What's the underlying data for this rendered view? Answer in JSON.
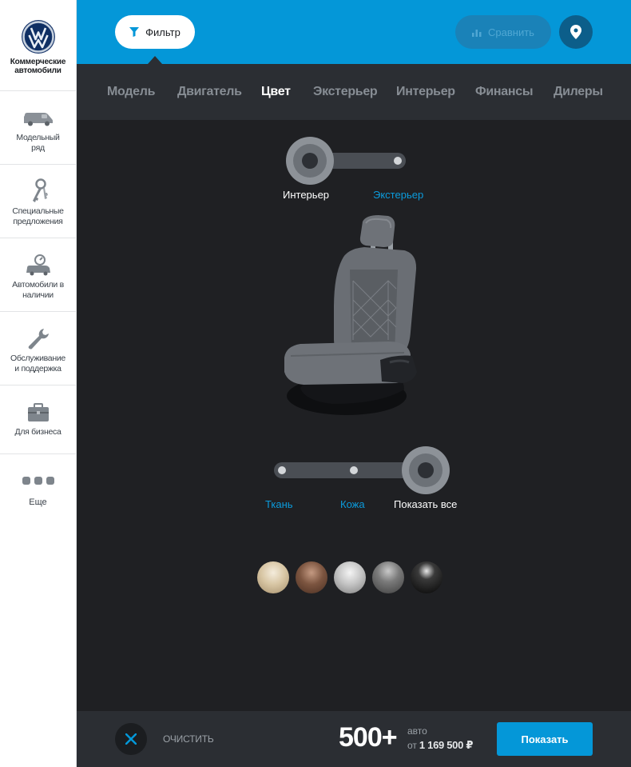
{
  "brand": {
    "logo_icon": "vw-logo-icon",
    "text_line1": "Коммерческие",
    "text_line2": "автомобили"
  },
  "sidebar": {
    "items": [
      {
        "icon": "van-icon",
        "line1": "Модельный",
        "line2": "ряд"
      },
      {
        "icon": "keys-icon",
        "line1": "Специальные",
        "line2": "предложения"
      },
      {
        "icon": "car-stock-icon",
        "line1": "Автомобили в",
        "line2": "наличии"
      },
      {
        "icon": "wrench-icon",
        "line1": "Обслуживание",
        "line2": "и поддержка"
      },
      {
        "icon": "briefcase-icon",
        "line1": "Для бизнеса",
        "line2": ""
      }
    ],
    "more_label": "Еще"
  },
  "topbar": {
    "filter_label": "Фильтр",
    "compare_label": "Сравнить",
    "location_icon": "map-pin-icon"
  },
  "tabs": [
    "Модель",
    "Двигатель",
    "Цвет",
    "Экстерьер",
    "Интерьер",
    "Финансы",
    "Дилеры"
  ],
  "active_tab": "Цвет",
  "view_toggle": {
    "options": [
      "Интерьер",
      "Экстерьер"
    ],
    "selected": "Интерьер"
  },
  "material_toggle": {
    "options": [
      "Ткань",
      "Кожа",
      "Показать все"
    ],
    "selected": "Показать все"
  },
  "swatches": [
    {
      "name": "beige",
      "color": "#c9b99c"
    },
    {
      "name": "brown",
      "color": "#7a5540"
    },
    {
      "name": "silver",
      "color": "#bcbcbc"
    },
    {
      "name": "grey",
      "color": "#6e6e6e"
    },
    {
      "name": "black",
      "color": "#141414"
    }
  ],
  "bottom": {
    "clear_label": "ОЧИСТИТЬ",
    "count": "500+",
    "unit": "авто",
    "price_prefix": "от",
    "price": "1 169 500 ₽",
    "show_label": "Показать"
  },
  "colors": {
    "accent": "#0497d8",
    "dark": "#2b2e33",
    "bg": "#1f2023"
  }
}
